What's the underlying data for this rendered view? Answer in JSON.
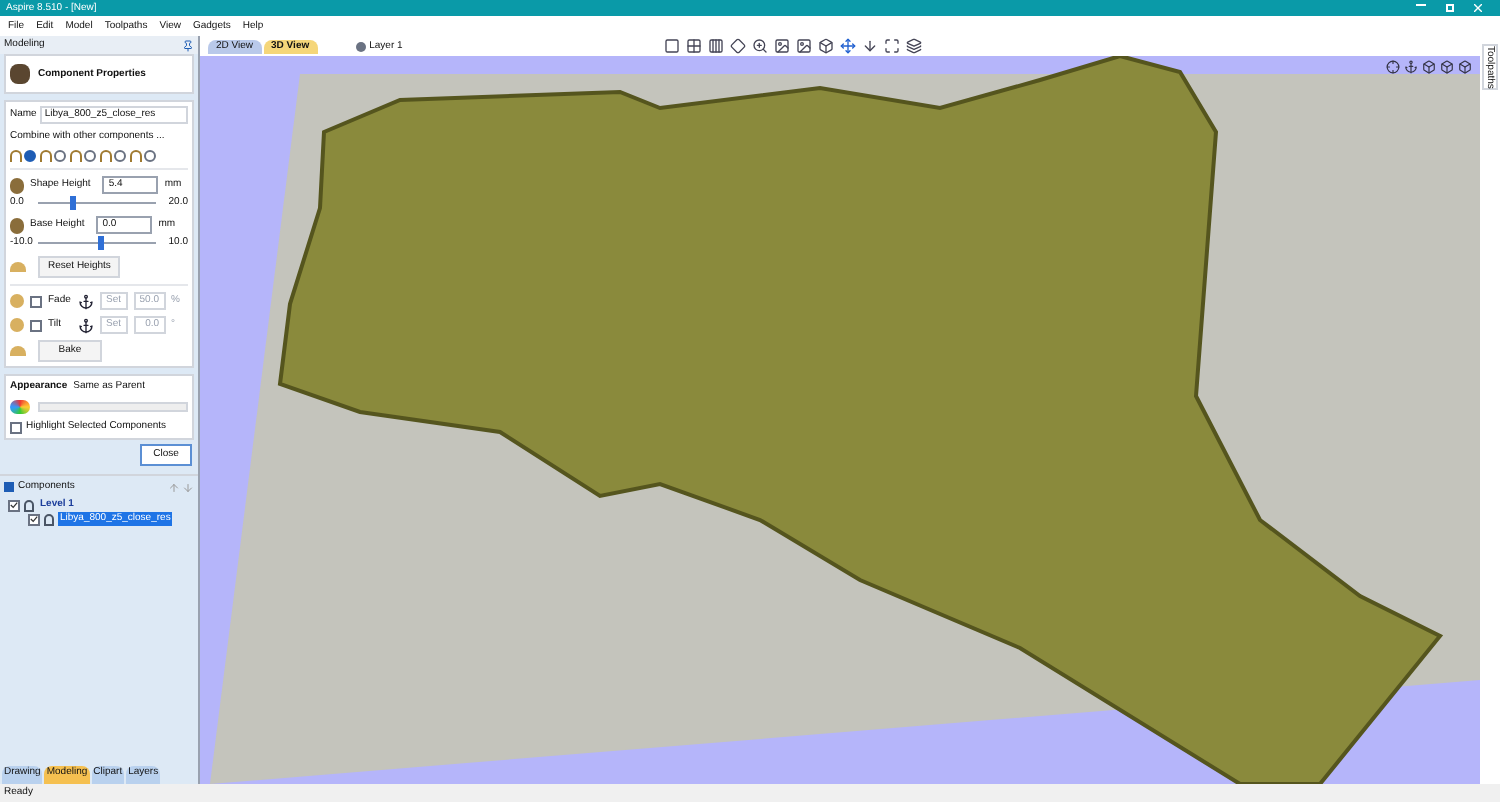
{
  "window": {
    "title": "Aspire 8.510 - [New]"
  },
  "menu": [
    "File",
    "Edit",
    "Model",
    "Toolpaths",
    "View",
    "Gadgets",
    "Help"
  ],
  "panel": {
    "title": "Modeling",
    "header": "Component Properties",
    "name_label": "Name",
    "name_value": "Libya_800_z5_close_res",
    "combine_label": "Combine with other components ...",
    "combine_modes": [
      {
        "selected": true
      },
      {
        "selected": false
      },
      {
        "selected": false
      },
      {
        "selected": false
      },
      {
        "selected": false
      }
    ],
    "shape_height": {
      "label": "Shape Height",
      "value": "5.4",
      "unit": "mm",
      "min": "0.0",
      "max": "20.0",
      "level": 0.27
    },
    "base_height": {
      "label": "Base Height",
      "value": "0.0",
      "unit": "mm",
      "min": "-10.0",
      "max": "10.0",
      "level": 0.5
    },
    "reset_button": "Reset Heights",
    "fade": {
      "label": "Fade",
      "checked": false,
      "disabled": true,
      "set": "Set",
      "value": "50.0",
      "unit": "%"
    },
    "tilt": {
      "label": "Tilt",
      "checked": false,
      "disabled": true,
      "set": "Set",
      "value": "0.0",
      "unit": "°"
    },
    "bake_button": "Bake",
    "appearance": {
      "label": "Appearance",
      "value": "Same as Parent"
    },
    "highlight": {
      "label": "Highlight Selected Components",
      "checked": false
    },
    "close_button": "Close"
  },
  "components": {
    "title": "Components",
    "tree": [
      {
        "label": "Level 1",
        "checked": true,
        "children": [
          {
            "label": "Libya_800_z5_close_res",
            "checked": true,
            "selected": true
          }
        ]
      }
    ]
  },
  "bottom_tabs": [
    {
      "label": "Drawing",
      "selected": false
    },
    {
      "label": "Modeling",
      "selected": true
    },
    {
      "label": "Clipart",
      "selected": false
    },
    {
      "label": "Layers",
      "selected": false
    }
  ],
  "view_tabs": [
    {
      "label": "2D View",
      "selected": false
    },
    {
      "label": "3D View",
      "selected": true
    }
  ],
  "layer": "Layer 1",
  "side_tab": "Toolpaths",
  "status_bar": "Ready"
}
